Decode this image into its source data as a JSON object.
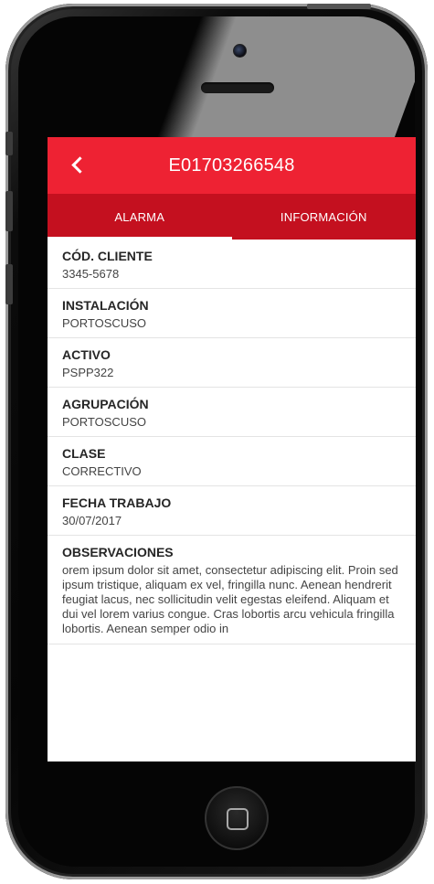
{
  "app": {
    "title": "E01703266548",
    "back_icon": "chevron-left-icon"
  },
  "tabs": [
    {
      "label": "ALARMA",
      "active": true
    },
    {
      "label": "INFORMACIÓN",
      "active": false
    }
  ],
  "fields": [
    {
      "label": "CÓD. CLIENTE",
      "value": "3345-5678"
    },
    {
      "label": "INSTALACIÓN",
      "value": "PORTOSCUSO"
    },
    {
      "label": "ACTIVO",
      "value": "PSPP322"
    },
    {
      "label": "AGRUPACIÓN",
      "value": "PORTOSCUSO"
    },
    {
      "label": "CLASE",
      "value": "CORRECTIVO"
    },
    {
      "label": "FECHA TRABAJO",
      "value": "30/07/2017"
    },
    {
      "label": "OBSERVACIONES",
      "value": "orem ipsum dolor sit amet, consectetur adipiscing elit. Proin sed ipsum tristique, aliquam ex vel, fringilla nunc. Aenean hendrerit feugiat lacus, nec sollicitudin velit egestas eleifend. Aliquam et dui vel lorem varius congue. Cras lobortis arcu vehicula fringilla lobortis. Aenean semper odio in"
    }
  ],
  "colors": {
    "appbar": "#ee2233",
    "tabbar": "#c4101f",
    "tab_indicator": "#ffffff"
  }
}
